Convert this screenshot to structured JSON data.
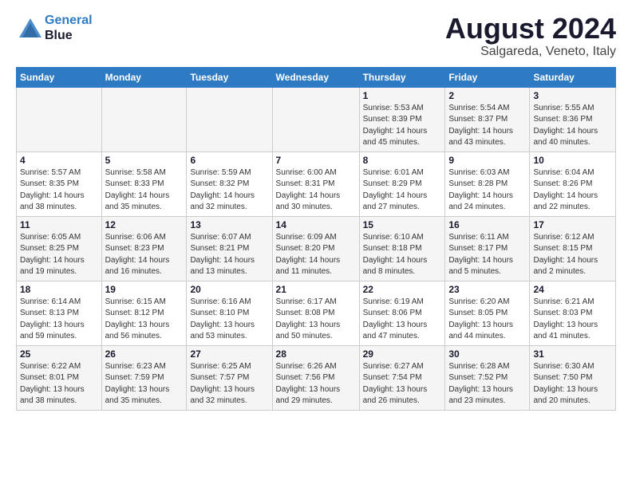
{
  "logo": {
    "line1": "General",
    "line2": "Blue"
  },
  "title": "August 2024",
  "location": "Salgareda, Veneto, Italy",
  "days_of_week": [
    "Sunday",
    "Monday",
    "Tuesday",
    "Wednesday",
    "Thursday",
    "Friday",
    "Saturday"
  ],
  "weeks": [
    [
      {
        "day": "",
        "info": ""
      },
      {
        "day": "",
        "info": ""
      },
      {
        "day": "",
        "info": ""
      },
      {
        "day": "",
        "info": ""
      },
      {
        "day": "1",
        "info": "Sunrise: 5:53 AM\nSunset: 8:39 PM\nDaylight: 14 hours\nand 45 minutes."
      },
      {
        "day": "2",
        "info": "Sunrise: 5:54 AM\nSunset: 8:37 PM\nDaylight: 14 hours\nand 43 minutes."
      },
      {
        "day": "3",
        "info": "Sunrise: 5:55 AM\nSunset: 8:36 PM\nDaylight: 14 hours\nand 40 minutes."
      }
    ],
    [
      {
        "day": "4",
        "info": "Sunrise: 5:57 AM\nSunset: 8:35 PM\nDaylight: 14 hours\nand 38 minutes."
      },
      {
        "day": "5",
        "info": "Sunrise: 5:58 AM\nSunset: 8:33 PM\nDaylight: 14 hours\nand 35 minutes."
      },
      {
        "day": "6",
        "info": "Sunrise: 5:59 AM\nSunset: 8:32 PM\nDaylight: 14 hours\nand 32 minutes."
      },
      {
        "day": "7",
        "info": "Sunrise: 6:00 AM\nSunset: 8:31 PM\nDaylight: 14 hours\nand 30 minutes."
      },
      {
        "day": "8",
        "info": "Sunrise: 6:01 AM\nSunset: 8:29 PM\nDaylight: 14 hours\nand 27 minutes."
      },
      {
        "day": "9",
        "info": "Sunrise: 6:03 AM\nSunset: 8:28 PM\nDaylight: 14 hours\nand 24 minutes."
      },
      {
        "day": "10",
        "info": "Sunrise: 6:04 AM\nSunset: 8:26 PM\nDaylight: 14 hours\nand 22 minutes."
      }
    ],
    [
      {
        "day": "11",
        "info": "Sunrise: 6:05 AM\nSunset: 8:25 PM\nDaylight: 14 hours\nand 19 minutes."
      },
      {
        "day": "12",
        "info": "Sunrise: 6:06 AM\nSunset: 8:23 PM\nDaylight: 14 hours\nand 16 minutes."
      },
      {
        "day": "13",
        "info": "Sunrise: 6:07 AM\nSunset: 8:21 PM\nDaylight: 14 hours\nand 13 minutes."
      },
      {
        "day": "14",
        "info": "Sunrise: 6:09 AM\nSunset: 8:20 PM\nDaylight: 14 hours\nand 11 minutes."
      },
      {
        "day": "15",
        "info": "Sunrise: 6:10 AM\nSunset: 8:18 PM\nDaylight: 14 hours\nand 8 minutes."
      },
      {
        "day": "16",
        "info": "Sunrise: 6:11 AM\nSunset: 8:17 PM\nDaylight: 14 hours\nand 5 minutes."
      },
      {
        "day": "17",
        "info": "Sunrise: 6:12 AM\nSunset: 8:15 PM\nDaylight: 14 hours\nand 2 minutes."
      }
    ],
    [
      {
        "day": "18",
        "info": "Sunrise: 6:14 AM\nSunset: 8:13 PM\nDaylight: 13 hours\nand 59 minutes."
      },
      {
        "day": "19",
        "info": "Sunrise: 6:15 AM\nSunset: 8:12 PM\nDaylight: 13 hours\nand 56 minutes."
      },
      {
        "day": "20",
        "info": "Sunrise: 6:16 AM\nSunset: 8:10 PM\nDaylight: 13 hours\nand 53 minutes."
      },
      {
        "day": "21",
        "info": "Sunrise: 6:17 AM\nSunset: 8:08 PM\nDaylight: 13 hours\nand 50 minutes."
      },
      {
        "day": "22",
        "info": "Sunrise: 6:19 AM\nSunset: 8:06 PM\nDaylight: 13 hours\nand 47 minutes."
      },
      {
        "day": "23",
        "info": "Sunrise: 6:20 AM\nSunset: 8:05 PM\nDaylight: 13 hours\nand 44 minutes."
      },
      {
        "day": "24",
        "info": "Sunrise: 6:21 AM\nSunset: 8:03 PM\nDaylight: 13 hours\nand 41 minutes."
      }
    ],
    [
      {
        "day": "25",
        "info": "Sunrise: 6:22 AM\nSunset: 8:01 PM\nDaylight: 13 hours\nand 38 minutes."
      },
      {
        "day": "26",
        "info": "Sunrise: 6:23 AM\nSunset: 7:59 PM\nDaylight: 13 hours\nand 35 minutes."
      },
      {
        "day": "27",
        "info": "Sunrise: 6:25 AM\nSunset: 7:57 PM\nDaylight: 13 hours\nand 32 minutes."
      },
      {
        "day": "28",
        "info": "Sunrise: 6:26 AM\nSunset: 7:56 PM\nDaylight: 13 hours\nand 29 minutes."
      },
      {
        "day": "29",
        "info": "Sunrise: 6:27 AM\nSunset: 7:54 PM\nDaylight: 13 hours\nand 26 minutes."
      },
      {
        "day": "30",
        "info": "Sunrise: 6:28 AM\nSunset: 7:52 PM\nDaylight: 13 hours\nand 23 minutes."
      },
      {
        "day": "31",
        "info": "Sunrise: 6:30 AM\nSunset: 7:50 PM\nDaylight: 13 hours\nand 20 minutes."
      }
    ]
  ]
}
